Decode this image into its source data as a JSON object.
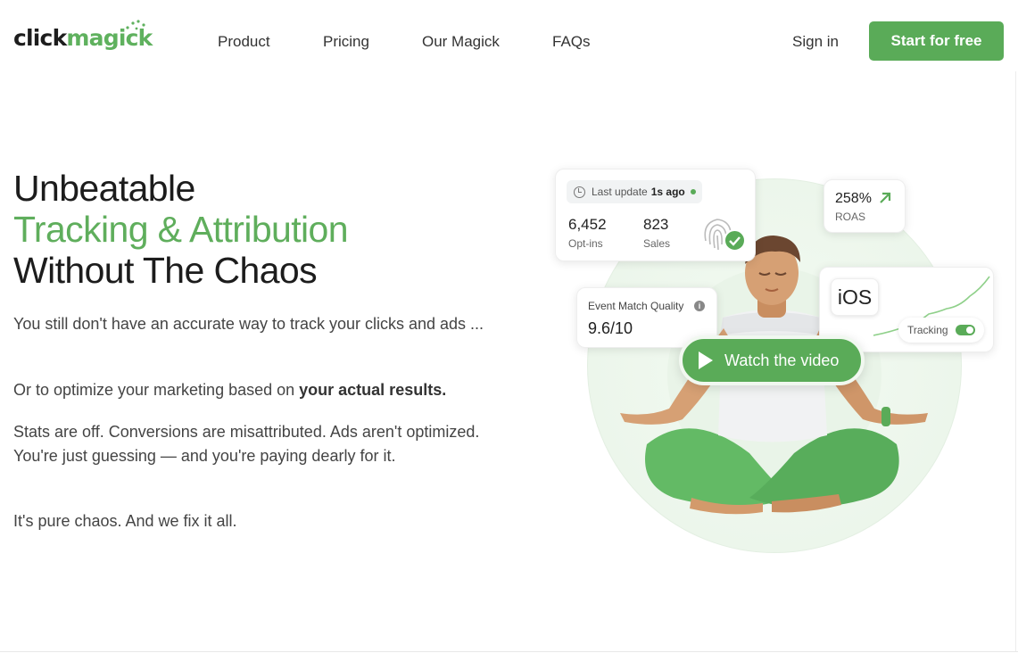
{
  "brand": {
    "logo_part1": "click",
    "logo_part2": "magick",
    "accent": "#5aab58"
  },
  "nav": {
    "items": [
      "Product",
      "Pricing",
      "Our Magick",
      "FAQs"
    ],
    "sign_in": "Sign in",
    "cta": "Start for free"
  },
  "hero": {
    "title_line1": "Unbeatable",
    "title_line2": "Tracking & Attribution",
    "title_line3": "Without The Chaos",
    "p1": "You still don't have an accurate way to track your clicks and ads ...",
    "p2_prefix": "Or to optimize your marketing based on ",
    "p2_bold": "your actual results.",
    "p3": "Stats are off. Conversions are misattributed. Ads aren't optimized. You're just guessing — and you're paying dearly for it.",
    "p4": "It's pure chaos. And we fix it all."
  },
  "illustration": {
    "last_update_label": "Last update",
    "last_update_value": "1s ago",
    "optins_value": "6,452",
    "optins_label": "Opt-ins",
    "sales_value": "823",
    "sales_label": "Sales",
    "roas_value": "258%",
    "roas_label": "ROAS",
    "ios_label": "iOS",
    "tracking_label": "Tracking",
    "emq_label": "Event Match Quality",
    "emq_value": "9.6/10",
    "watch_video": "Watch the video"
  }
}
